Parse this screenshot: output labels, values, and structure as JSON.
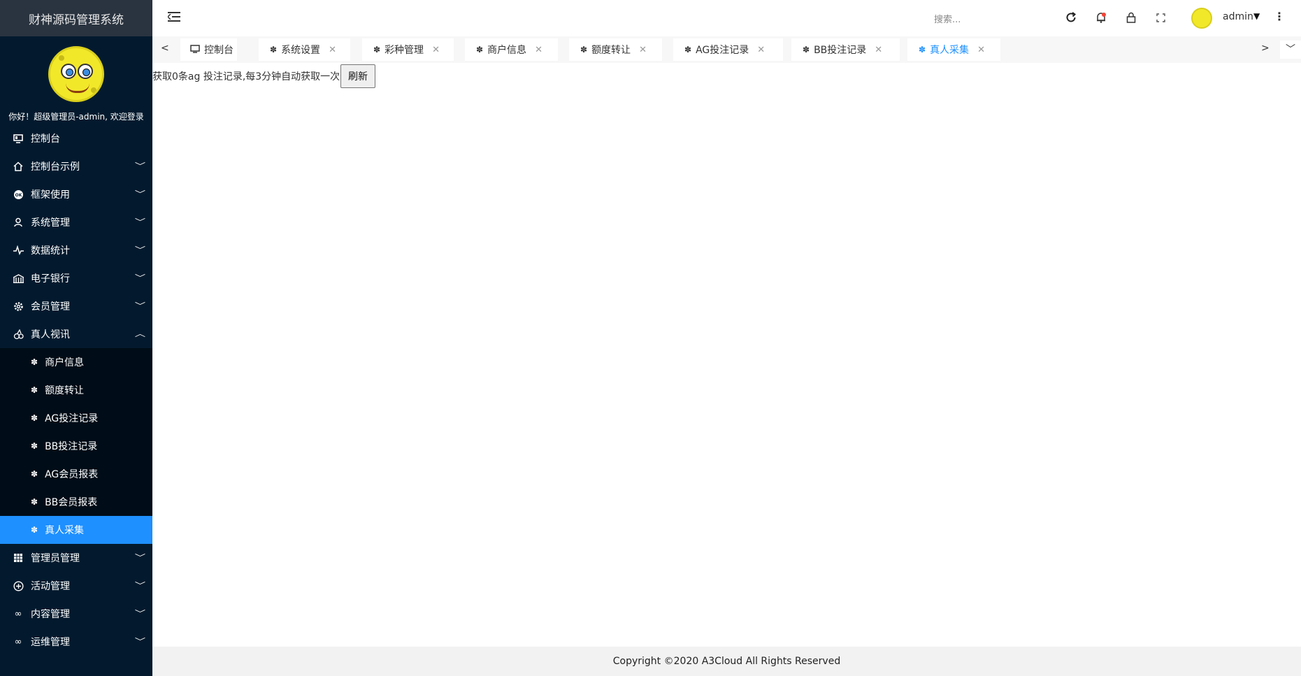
{
  "app": {
    "title": "财神源码管理系统"
  },
  "profile": {
    "welcome": "你好！超级管理员-admin, 欢迎登录"
  },
  "sidebar": {
    "items": [
      {
        "label": "控制台",
        "icon": "monitor-icon",
        "has_children": false
      },
      {
        "label": "控制台示例",
        "icon": "home-icon",
        "has_children": true
      },
      {
        "label": "框架使用",
        "icon": "ok-icon",
        "has_children": true
      },
      {
        "label": "系统管理",
        "icon": "user-icon",
        "has_children": true
      },
      {
        "label": "数据统计",
        "icon": "pulse-icon",
        "has_children": true
      },
      {
        "label": "电子银行",
        "icon": "bank-icon",
        "has_children": true
      },
      {
        "label": "会员管理",
        "icon": "gear-icon",
        "has_children": true
      },
      {
        "label": "真人视讯",
        "icon": "tree-icon",
        "has_children": true,
        "expanded": true
      }
    ],
    "submenu": [
      {
        "label": "商户信息"
      },
      {
        "label": "额度转让"
      },
      {
        "label": "AG投注记录"
      },
      {
        "label": "BB投注记录"
      },
      {
        "label": "AG会员报表"
      },
      {
        "label": "BB会员报表"
      },
      {
        "label": "真人采集",
        "active": true
      }
    ],
    "items_after": [
      {
        "label": "管理员管理",
        "icon": "grid-icon"
      },
      {
        "label": "活动管理",
        "icon": "plus-circle-icon"
      },
      {
        "label": "内容管理",
        "icon": "infinity-icon"
      },
      {
        "label": "运维管理",
        "icon": "infinity-icon"
      }
    ]
  },
  "header": {
    "search_placeholder": "搜索...",
    "user_name": "admin",
    "icons": [
      "menu-toggle-icon",
      "refresh-icon",
      "bell-icon",
      "lock-icon",
      "fullscreen-icon",
      "more-icon"
    ]
  },
  "tabs": [
    {
      "label": "控制台",
      "closable": false
    },
    {
      "label": "系统设置",
      "closable": true
    },
    {
      "label": "彩种管理",
      "closable": true
    },
    {
      "label": "商户信息",
      "closable": true
    },
    {
      "label": "额度转让",
      "closable": true
    },
    {
      "label": "AG投注记录",
      "closable": true
    },
    {
      "label": "BB投注记录",
      "closable": true
    },
    {
      "label": "真人采集",
      "closable": true,
      "active": true
    }
  ],
  "main": {
    "status_text": "获取0条ag 投注记录,每3分钟自动获取一次",
    "refresh_label": "刷新"
  },
  "footer": {
    "copyright": "Copyright ©2020 A3Cloud All Rights Reserved"
  },
  "colors": {
    "sidebar_bg": "#031a2e",
    "submenu_bg": "#000c17",
    "active": "#1e90ff",
    "logo_bg": "#2a3440"
  }
}
